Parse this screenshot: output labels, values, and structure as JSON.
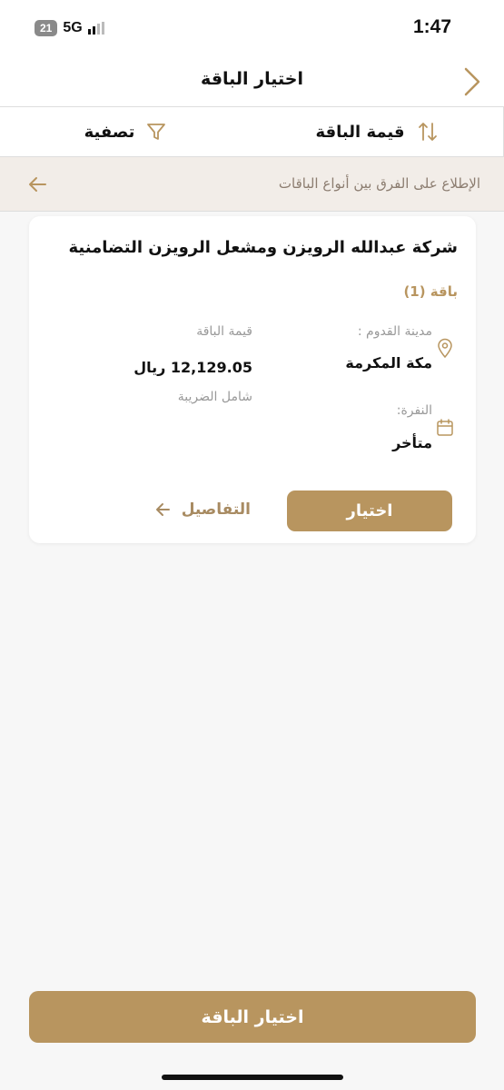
{
  "status_bar": {
    "time": "1:47",
    "battery": "21",
    "network": "5G"
  },
  "nav": {
    "title": "اختيار الباقة"
  },
  "toolbar": {
    "filter_label": "تصفية",
    "sort_label": "قيمة الباقة"
  },
  "info_strip": {
    "text": "الإطلاع على الفرق بين أنواع الباقات"
  },
  "card": {
    "company": "شركة عبدالله الرويزن ومشعل الرويزن التضامنية",
    "package_label": "باقة (1)",
    "arrival_city_label": "مدينة القدوم :",
    "arrival_city_value": "مكة المكرمة",
    "price_label": "قيمة الباقة",
    "price_value": "12,129.05 ريال",
    "tax_note": "شامل الضريبة",
    "batch_label": "النفرة:",
    "batch_value": "متأخر",
    "select_button": "اختيار",
    "details_link": "التفاصيل"
  },
  "bottom": {
    "select_package_button": "اختيار الباقة"
  },
  "colors": {
    "accent": "#b8955f",
    "strip_bg": "#f2ede8",
    "page_bg": "#f7f7f7"
  }
}
